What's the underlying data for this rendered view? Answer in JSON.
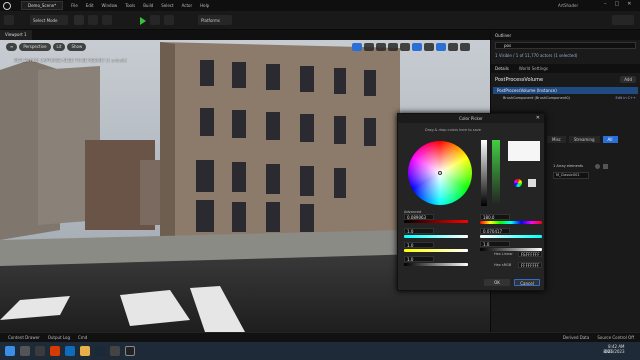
{
  "menubar": {
    "project_tab": "Demo_Scene*",
    "items": [
      "File",
      "Edit",
      "Window",
      "Tools",
      "Build",
      "Select",
      "Actor",
      "Help"
    ],
    "level_tab": "lvl_Classic001*",
    "app_name": "ArtShader"
  },
  "toolbar": {
    "select_mode": "Select Mode",
    "platforms": "Platforms"
  },
  "viewport": {
    "tab": "Viewport 1",
    "perspective": "Perspective",
    "lit": "Lit",
    "show": "Show",
    "warning": "REFLECTION CAPTURES NEED TO BE REBUILT (1 unbuilt)"
  },
  "outliner": {
    "tab": "Outliner",
    "search_value": "pos",
    "status": "1 Visible / 1 of 11,770 actors (1 selected)"
  },
  "details": {
    "tabs": [
      "Details",
      "World Settings"
    ],
    "actor_name": "PostProcessVolume",
    "add_label": "Add",
    "component_root": "PostProcessVolume (Instance)",
    "component_child": "BrushComponent (BrushComponent0)",
    "component_child_link": "Edit in C++",
    "section": "sRGB Preview",
    "tabs2": [
      "Misc",
      "Streaming",
      "All"
    ],
    "array_label": "1 Array elements",
    "material_value": "M_Classic001",
    "new_label": "New"
  },
  "color_picker": {
    "title": "Color Picker",
    "hint": "Drag & drop colors here to save",
    "advanced": "Advanced",
    "values": {
      "r": "0.089063",
      "g": "1.0",
      "b": "1.0",
      "a": "1.0",
      "h": "180.0",
      "s": "0.070417",
      "v": "1.0",
      "hex_linear": "FEFFFFFF",
      "hex_srgb": "FFFFFFFF"
    },
    "hex_linear_label": "Hex Linear",
    "hex_srgb_label": "Hex sRGB",
    "ok": "OK",
    "cancel": "Cancel"
  },
  "statusbar": {
    "content_drawer": "Content Drawer",
    "output_log": "Output Log",
    "cmd": "Cmd",
    "derived_data": "Derived Data",
    "source_control": "Source Control Off"
  },
  "taskbar": {
    "lang": "ENG",
    "time": "8:42 AM",
    "date": "4/26/2023"
  },
  "colors": {
    "accent": "#2a6fd6",
    "play_green": "#3cbf3c",
    "selection": "#1f4a82"
  }
}
